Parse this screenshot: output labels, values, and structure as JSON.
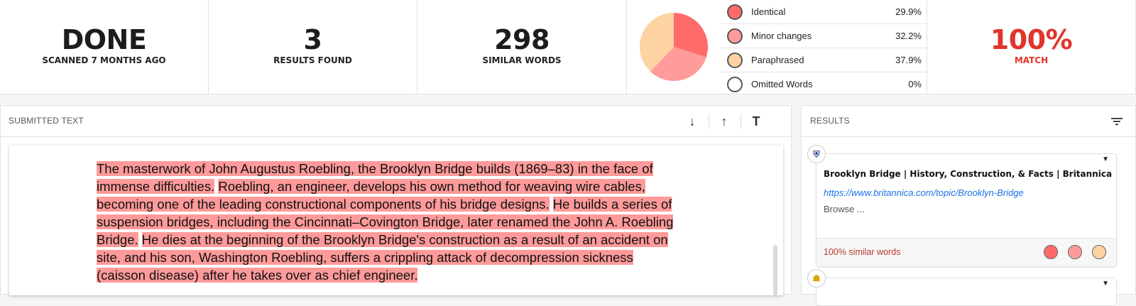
{
  "stats": {
    "status": {
      "value": "DONE",
      "label": "SCANNED 7 MONTHS AGO"
    },
    "results": {
      "value": "3",
      "label": "RESULTS FOUND"
    },
    "similar": {
      "value": "298",
      "label": "SIMILAR WORDS"
    },
    "match": {
      "value": "100%",
      "label": "MATCH"
    }
  },
  "breakdown": {
    "legend": [
      {
        "label": "Identical",
        "pct": "29.9%",
        "value": 29.9,
        "color": "#ff6b6b"
      },
      {
        "label": "Minor changes",
        "pct": "32.2%",
        "value": 32.2,
        "color": "#ff9b9b"
      },
      {
        "label": "Paraphrased",
        "pct": "37.9%",
        "value": 37.9,
        "color": "#fed3a4"
      },
      {
        "label": "Omitted Words",
        "pct": "0%",
        "value": 0,
        "color": "#ffffff"
      }
    ]
  },
  "submitted": {
    "title": "SUBMITTED TEXT",
    "tools": {
      "down": "↓",
      "up": "↑",
      "text": "T"
    },
    "sentences": [
      "The masterwork of John Augustus Roebling, the Brooklyn Bridge builds (1869–83) in the face of immense difficulties.",
      "Roebling, an engineer, develops his own method for weaving wire cables, becoming one of the leading constructional components of his bridge designs.",
      "He builds a series of suspension bridges, including the Cincinnati–Covington Bridge, later renamed the John A. Roebling Bridge.",
      "He dies at the beginning of the Brooklyn Bridge's construction as a result of an accident on site, and his son, Washington Roebling, suffers a crippling attack of decompression sickness (caisson disease) after he takes over as chief engineer."
    ]
  },
  "results": {
    "title": "RESULTS",
    "cards": [
      {
        "title": "Brooklyn Bridge | History, Construction, & Facts | Britannica",
        "url": "https://www.britannica.com/topic/Brooklyn-Bridge",
        "snippet": "Browse ...",
        "similarity": "100% similar words",
        "caret": "▼"
      },
      {
        "caret": "▼"
      }
    ]
  }
}
